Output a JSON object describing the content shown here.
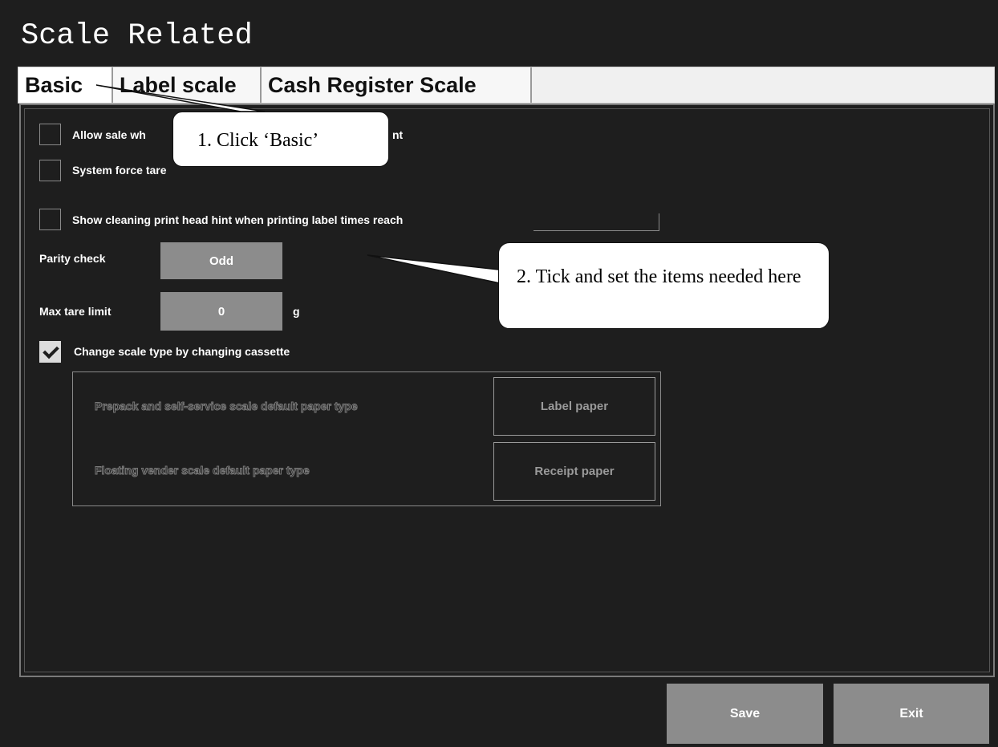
{
  "window": {
    "title": "Scale Related"
  },
  "tabs": [
    {
      "label": "Basic"
    },
    {
      "label": "Label scale"
    },
    {
      "label": "Cash Register Scale"
    }
  ],
  "options": {
    "allow_sale_label": "Allow sale wh",
    "allow_sale_label_tail": "nt",
    "system_force_tare_label": "System force tare",
    "cleaning_hint_label": "Show cleaning print head hint when printing label times reach",
    "cleaning_hint_value": "",
    "parity_check_label": "Parity check",
    "parity_check_value": "Odd",
    "max_tare_label": "Max tare limit",
    "max_tare_value": "0",
    "max_tare_unit": "g",
    "change_scale_type_label": "Change scale type by changing cassette",
    "change_scale_type_checked": true
  },
  "paper_group": {
    "prepack_label": "Prepack and self-service scale default paper type",
    "prepack_value": "Label paper",
    "floating_label": "Floating vender scale default paper type",
    "floating_value": "Receipt paper"
  },
  "footer": {
    "save_label": "Save",
    "exit_label": "Exit"
  },
  "callouts": {
    "step1": "1. Click ‘Basic’",
    "step2": "2. Tick and set the items needed here"
  }
}
